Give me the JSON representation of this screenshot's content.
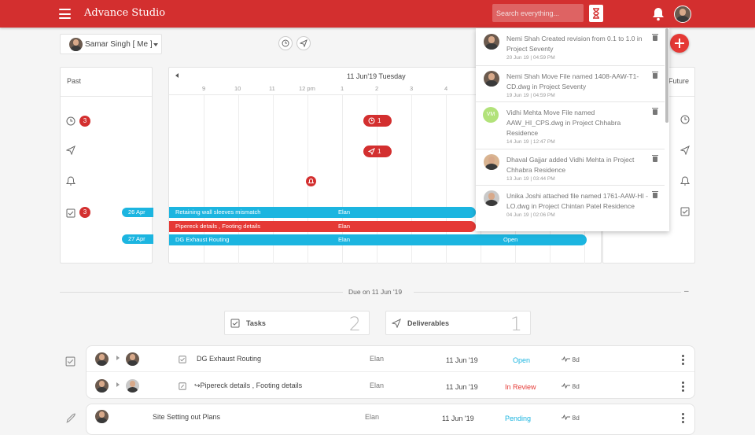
{
  "app": {
    "title": "Advance Studio"
  },
  "header": {
    "search_placeholder": "Search everything..."
  },
  "user_select": {
    "label": "Samar Singh [ Me ]"
  },
  "past": {
    "label": "Past",
    "counts": {
      "clock": "3",
      "tasks": "3"
    },
    "dates": [
      "26 Apr",
      "27 Apr"
    ]
  },
  "future": {
    "label": "Future"
  },
  "timeline": {
    "date_label": "11 Jun'19 Tuesday",
    "hours": [
      "9",
      "10",
      "11",
      "12 pm",
      "1",
      "2",
      "3",
      "4"
    ],
    "pills": {
      "clock": "1",
      "plane": "1"
    },
    "bars": [
      {
        "title": "Retaining wall sleeves mismatch",
        "person": "Elan",
        "status": "",
        "color": "#1cb5e0"
      },
      {
        "title": "Pipereck details , Footing details",
        "person": "Elan",
        "status": "",
        "color": "#e53935"
      },
      {
        "title": "DG Exhaust Routing",
        "person": "Elan",
        "status": "Open",
        "color": "#1cb5e0"
      }
    ]
  },
  "notifications": [
    {
      "text": "Nemi Shah Created revision from 0.1 to 1.0 in Project Seventy",
      "time": "20 Jun 19 | 04:59 PM"
    },
    {
      "text": "Nemi Shah Move File named 1408-AAW-T1-CD.dwg in Project Seventy",
      "time": "19 Jun 19 | 04:59 PM"
    },
    {
      "initials": "VM",
      "text": "Vidhi Mehta Move File named AAW_HI_CPS.dwg in Project Chhabra Residence",
      "time": "14 Jun 19 | 12:47 PM"
    },
    {
      "text": "Dhaval Gajjar added  Vidhi Mehta in Project Chhabra Residence",
      "time": "13 Jun 19 | 03:44 PM"
    },
    {
      "text": "Unika Joshi attached file named 1761-AAW-HI -LO.dwg in Project Chintan Patel Residence",
      "time": "04 Jun 19 | 02:06 PM"
    }
  ],
  "due": {
    "label": "Due on 11 Jun '19",
    "collapse": "–"
  },
  "cards": {
    "tasks": {
      "label": "Tasks",
      "count": "2"
    },
    "deliverables": {
      "label": "Deliverables",
      "count": "1"
    }
  },
  "tasks": [
    {
      "title": "DG Exhaust Routing",
      "person": "Elan",
      "date": "11 Jun '19",
      "status": "Open",
      "status_color": "#1cb5e0",
      "duration": "8d"
    },
    {
      "title": "↪Pipereck details , Footing details",
      "person": "Elan",
      "date": "11 Jun '19",
      "status": "In Review",
      "status_color": "#e53935",
      "duration": "8d"
    }
  ],
  "deliverables": [
    {
      "title": "Site Setting out Plans",
      "person": "Elan",
      "date": "11 Jun '19",
      "status": "Pending",
      "status_color": "#1cb5e0",
      "duration": "8d"
    }
  ]
}
